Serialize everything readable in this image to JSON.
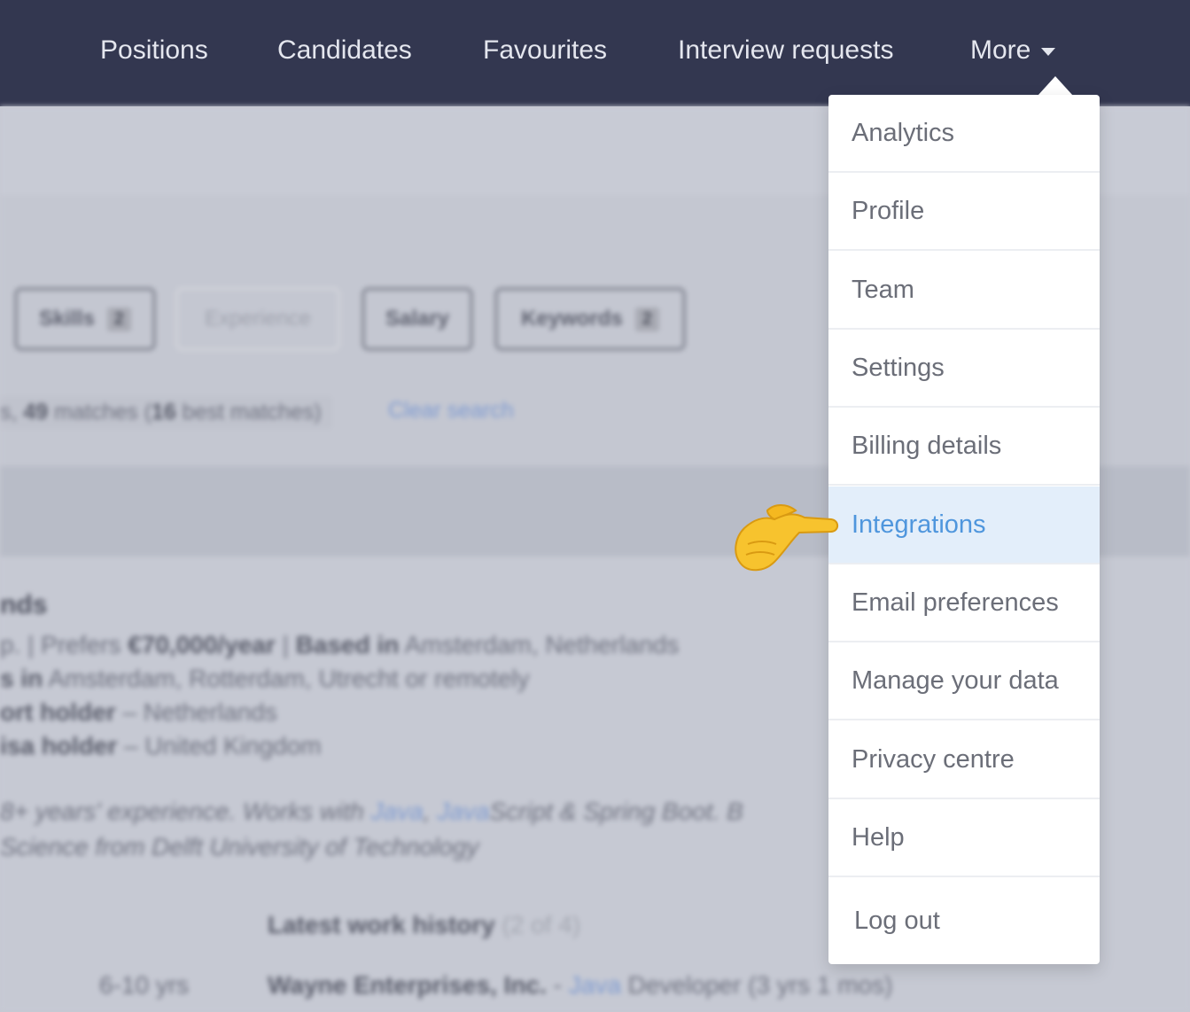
{
  "nav": {
    "positions": "Positions",
    "candidates": "Candidates",
    "favourites": "Favourites",
    "interview_requests": "Interview requests",
    "more": "More"
  },
  "background": {
    "filters": {
      "skills": "Skills",
      "skills_count": "2",
      "experience": "Experience",
      "salary": "Salary",
      "keywords": "Keywords",
      "keywords_count": "2"
    },
    "matches": {
      "prefix": "s, ",
      "count": "49",
      "mid": " matches (",
      "best": "16",
      "suffix": " best matches)"
    },
    "clear_search": "Clear search",
    "candidate": {
      "name_fragment": "nds",
      "line1_a": "p. | Prefers ",
      "line1_b": "€70,000/year",
      "line1_c": " | ",
      "line1_d": "Based in",
      "line1_e": " Amsterdam, Netherlands",
      "line2_a": "s in",
      "line2_b": " Amsterdam, Rotterdam, Utrecht or remotely",
      "line3_a": "ort holder",
      "line3_b": " – Netherlands",
      "line4_a": "isa holder",
      "line4_b": " – United Kingdom",
      "summary1_a": "8+ years' experience. Works with ",
      "summary1_b": "Java",
      "summary1_c": ", ",
      "summary1_d": "Java",
      "summary1_e": "Script & Spring Boot. B",
      "summary2": "Science from Delft University of Technology",
      "work_title": "Latest work history",
      "work_count": "(2 of 4)",
      "years": "6-10 yrs",
      "company": "Wayne Enterprises, Inc.",
      "dash": " - ",
      "role_a": "Java",
      "role_b": " Developer (3 yrs 1 mos)"
    }
  },
  "menu": {
    "items": [
      {
        "label": "Analytics"
      },
      {
        "label": "Profile"
      },
      {
        "label": "Team"
      },
      {
        "label": "Settings"
      },
      {
        "label": "Billing details"
      },
      {
        "label": "Integrations"
      },
      {
        "label": "Email preferences"
      },
      {
        "label": "Manage your data"
      },
      {
        "label": "Privacy centre"
      },
      {
        "label": "Help"
      },
      {
        "label": "Log out"
      }
    ]
  },
  "colors": {
    "nav_bg": "#333750",
    "active_item_bg": "#e3eefa",
    "active_item_text": "#4f96dd"
  },
  "icons": {
    "pointer": "pointing-hand-icon",
    "caret": "caret-down-icon"
  }
}
